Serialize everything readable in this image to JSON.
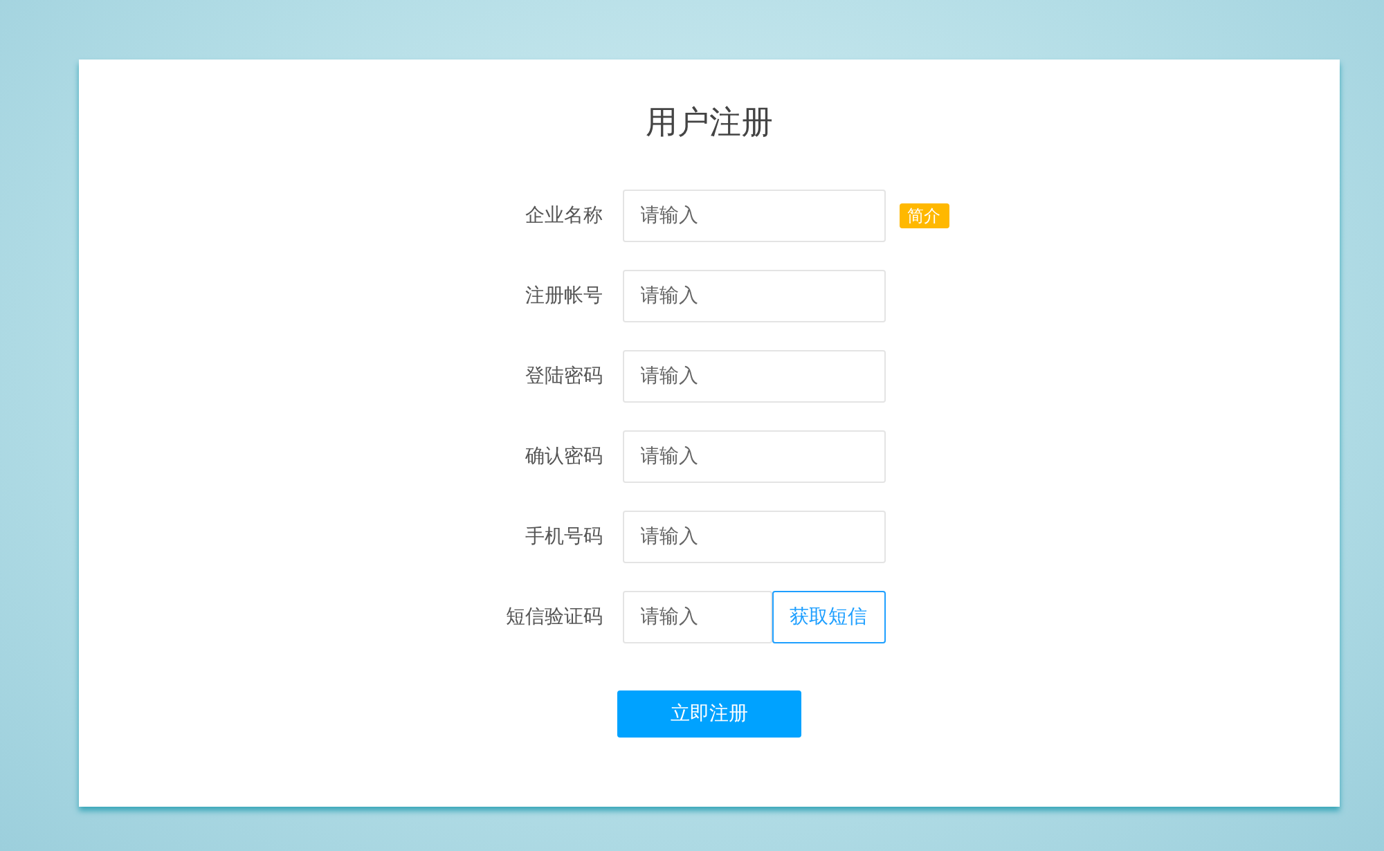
{
  "title": "用户注册",
  "fields": [
    {
      "label": "企业名称",
      "placeholder": "请输入",
      "kind": "badge",
      "extra": "简介"
    },
    {
      "label": "注册帐号",
      "placeholder": "请输入",
      "kind": "plain"
    },
    {
      "label": "登陆密码",
      "placeholder": "请输入",
      "kind": "plain"
    },
    {
      "label": "确认密码",
      "placeholder": "请输入",
      "kind": "plain"
    },
    {
      "label": "手机号码",
      "placeholder": "请输入",
      "kind": "plain"
    },
    {
      "label": "短信验证码",
      "placeholder": "请输入",
      "kind": "action",
      "extra": "获取短信"
    }
  ],
  "submit": "立即注册"
}
